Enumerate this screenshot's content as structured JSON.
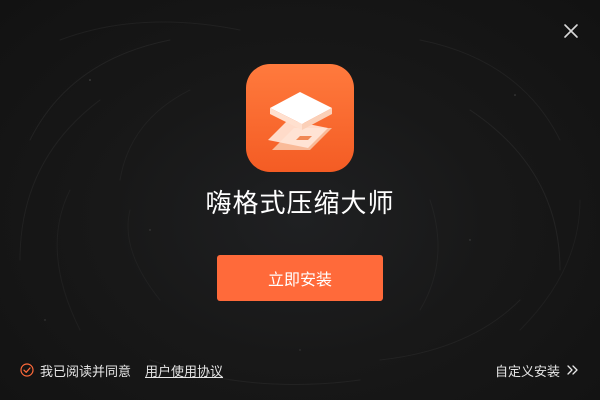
{
  "window": {
    "close_icon": "close-icon"
  },
  "app": {
    "icon": "layered-paper-logo-icon",
    "name": "嗨格式压缩大师"
  },
  "install": {
    "button_label": "立即安装"
  },
  "agreement": {
    "checked": true,
    "text": "我已阅读并同意",
    "link_label": "用户使用协议"
  },
  "custom": {
    "label": "自定义安装",
    "icon": "double-chevron-right-icon"
  },
  "colors": {
    "accent": "#ff6a3a",
    "icon_gradient_top": "#ff7a3d",
    "icon_gradient_bottom": "#f45c24",
    "background": "#161616",
    "text": "#ffffff"
  }
}
